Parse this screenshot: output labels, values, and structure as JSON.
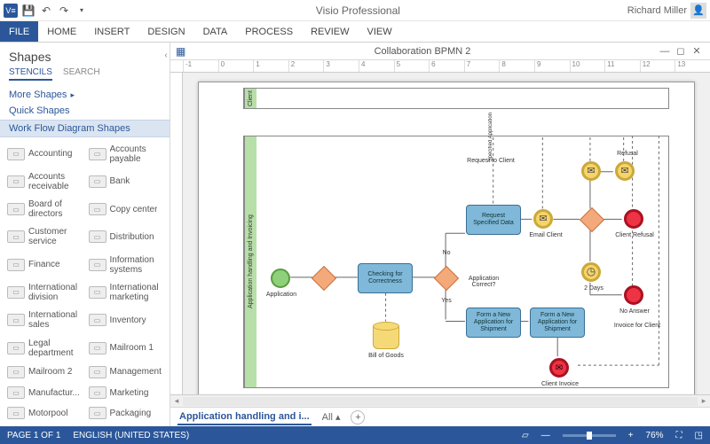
{
  "app": {
    "title": "Visio Professional",
    "user": "Richard Miller"
  },
  "qat": {
    "save": "💾",
    "undo": "↶",
    "redo": "↷"
  },
  "ribbon": {
    "tabs": [
      "FILE",
      "HOME",
      "INSERT",
      "DESIGN",
      "DATA",
      "PROCESS",
      "REVIEW",
      "VIEW"
    ]
  },
  "doc": {
    "title": "Collaboration BPMN 2"
  },
  "shapes": {
    "heading": "Shapes",
    "subtabs": {
      "stencils": "STENCILS",
      "search": "SEARCH"
    },
    "more": "More Shapes",
    "quick": "Quick Shapes",
    "stencil_header": "Work Flow Diagram Shapes",
    "items": [
      "Accounting",
      "Accounts payable",
      "Accounts receivable",
      "Bank",
      "Board of directors",
      "Copy center",
      "Customer service",
      "Distribution",
      "Finance",
      "Information systems",
      "International division",
      "International marketing",
      "International sales",
      "Inventory",
      "Legal department",
      "Mailroom 1",
      "Mailroom 2",
      "Management",
      "Manufactur...",
      "Marketing",
      "Motorpool",
      "Packaging"
    ]
  },
  "ruler": [
    "-1",
    "0",
    "1",
    "2",
    "3",
    "4",
    "5",
    "6",
    "7",
    "8",
    "9",
    "10",
    "11",
    "12",
    "13"
  ],
  "diagram": {
    "pool_client": "Client",
    "pool_app": "Application handling and Invoicing",
    "lane_spec": "Specified Application",
    "start": "Application",
    "task_check": "Checking for Correctness",
    "task_request": "Request Specified Data",
    "task_form_new": "Form a New Application for Shipment",
    "task_form_new2": "Form a New Application for Shipment",
    "gw_question": "Application Correct?",
    "gw_yes": "Yes",
    "gw_no": "No",
    "data_bill": "Bill of Goods",
    "msg_request": "Request to Client",
    "msg_email": "Email Client",
    "msg_refusal": "Refusal",
    "end_refusal": "Client Refusal",
    "end_noanswer": "No Answer",
    "timer_2days": "2 Days",
    "end_invoice": "Client Invoice",
    "msg_invoice": "Invoice for Client"
  },
  "tabs": {
    "page": "Application handling and i...",
    "all": "All",
    "add_tip": "New Page"
  },
  "status": {
    "page": "PAGE 1 OF 1",
    "lang": "ENGLISH (UNITED STATES)",
    "zoom": "76%"
  }
}
